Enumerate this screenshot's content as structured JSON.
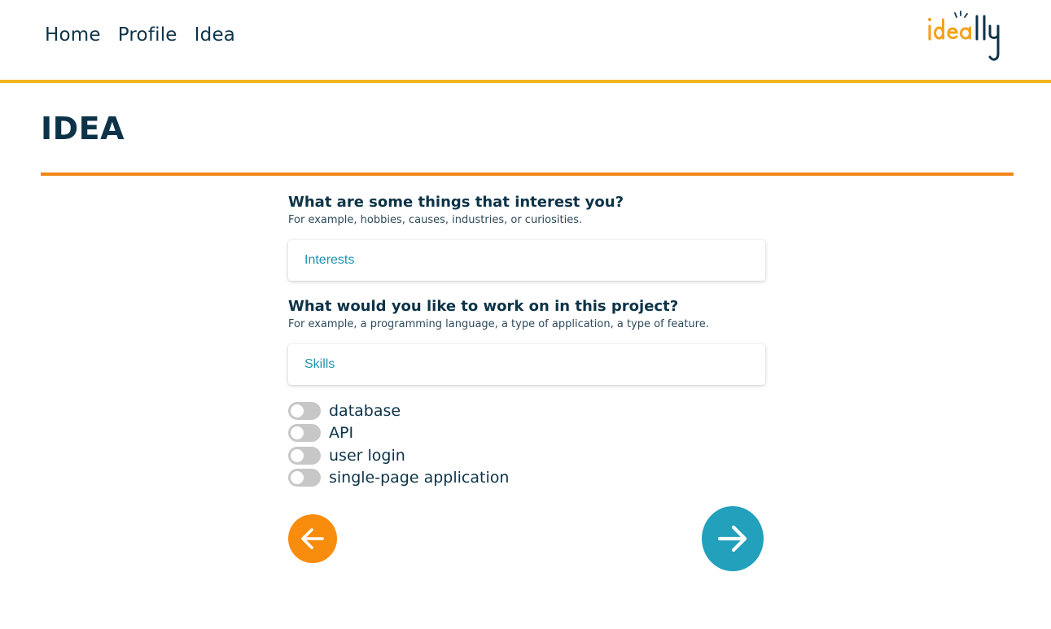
{
  "nav": {
    "items": [
      {
        "label": "Home"
      },
      {
        "label": "Profile"
      },
      {
        "label": "Idea"
      }
    ]
  },
  "logo": {
    "text": "ideally",
    "colors": {
      "ide": "#f4a21c",
      "ally": "#0d3348",
      "accent": "#0d3348"
    }
  },
  "page": {
    "title": "IDEA"
  },
  "interests": {
    "question": "What are some things that interest you?",
    "hint": "For example, hobbies, causes, industries, or curiosities.",
    "placeholder": "Interests",
    "value": ""
  },
  "skills": {
    "question": "What would you like to work on in this project?",
    "hint": "For example, a programming language, a type of application, a type of feature.",
    "placeholder": "Skills",
    "value": ""
  },
  "features": [
    {
      "label": "database",
      "enabled": false
    },
    {
      "label": "API",
      "enabled": false
    },
    {
      "label": "user login",
      "enabled": false
    },
    {
      "label": "single-page application",
      "enabled": false
    }
  ],
  "buttons": {
    "back_icon": "arrow-left-icon",
    "next_icon": "arrow-right-icon"
  },
  "colors": {
    "primary_text": "#0d3348",
    "header_rule": "#f4b51f",
    "title_rule": "#f0861a",
    "back_button": "#f88c0c",
    "next_button": "#22a0bc",
    "input_text": "#1f94b0",
    "toggle_off": "#c7c7c7"
  }
}
